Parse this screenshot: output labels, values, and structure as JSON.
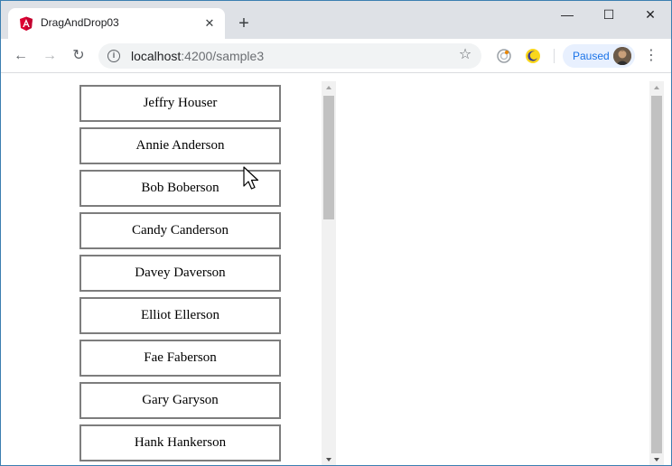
{
  "tab": {
    "title": "DragAndDrop03",
    "close_glyph": "✕",
    "favicon": "angular-icon"
  },
  "new_tab_glyph": "+",
  "window_controls": {
    "minimize_glyph": "—",
    "maximize_glyph": "☐",
    "close_glyph": "✕"
  },
  "toolbar": {
    "back_glyph": "←",
    "forward_glyph": "→",
    "reload_glyph": "↻",
    "url_host": "localhost",
    "url_path": ":4200/sample3",
    "star_glyph": "☆",
    "paused_label": "Paused",
    "menu_glyph": "⋮"
  },
  "people": [
    "Jeffry Houser",
    "Annie Anderson",
    "Bob Boberson",
    "Candy Canderson",
    "Davey Daverson",
    "Elliot Ellerson",
    "Fae Faberson",
    "Gary Garyson",
    "Hank Hankerson"
  ],
  "colors": {
    "angular_red": "#dd0031",
    "box_border": "#7d7d7d",
    "paused_blue": "#1a73e8"
  }
}
